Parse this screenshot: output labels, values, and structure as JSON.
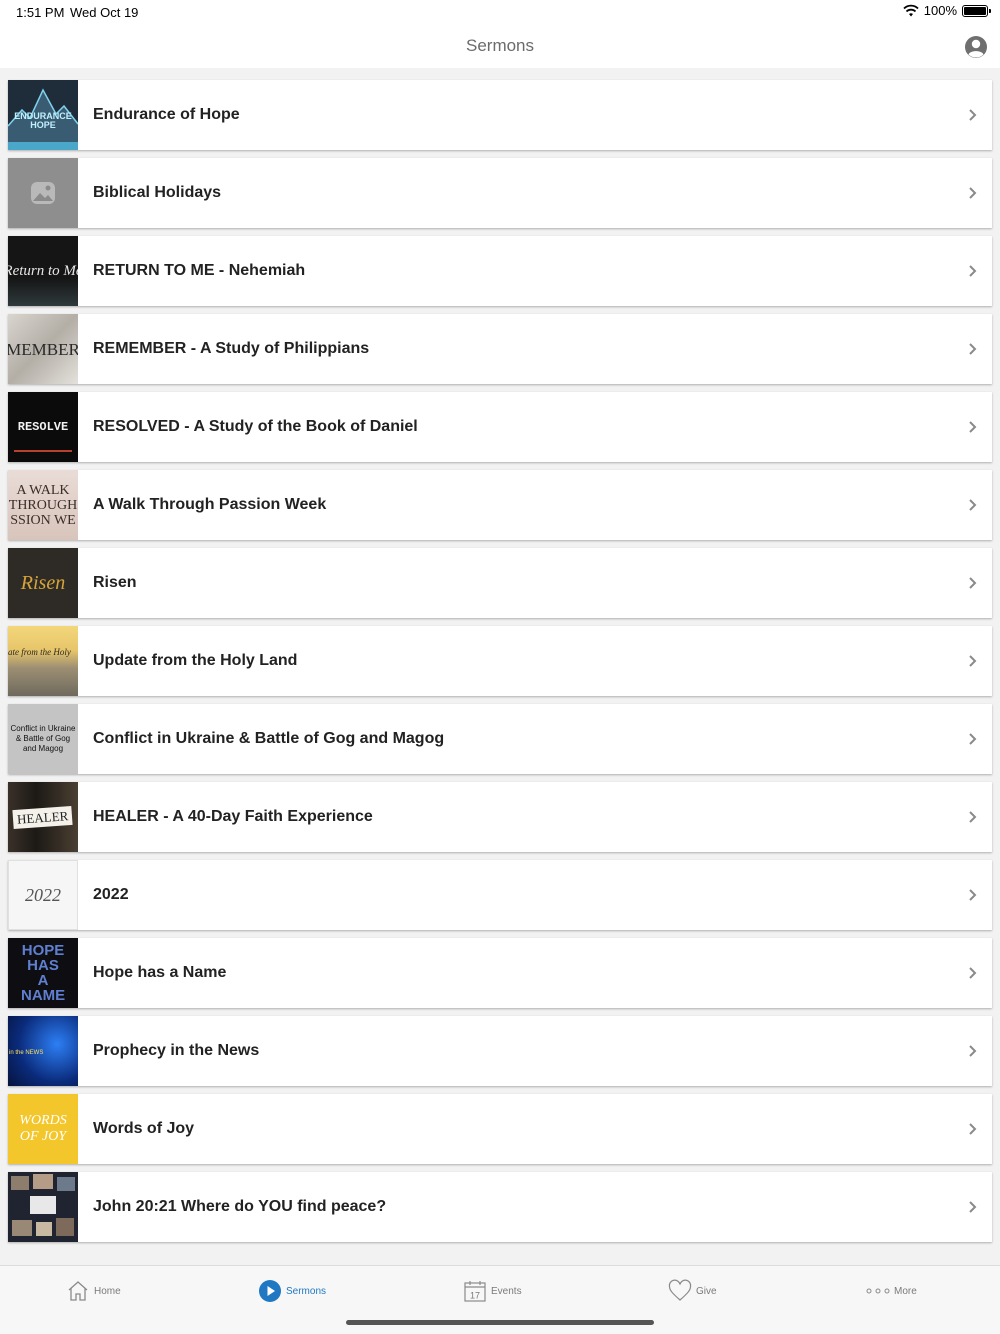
{
  "status_bar": {
    "time": "1:51 PM",
    "date": "Wed Oct 19",
    "battery": "100%"
  },
  "nav": {
    "title": "Sermons"
  },
  "sermons": [
    {
      "title": "Endurance of Hope",
      "thumb_text": "ENDURANCE HOPE",
      "thumb_icon": "mountain-art"
    },
    {
      "title": "Biblical Holidays",
      "thumb_text": "",
      "thumb_icon": "image-placeholder"
    },
    {
      "title": "RETURN TO ME - Nehemiah",
      "thumb_text": "Return to Me"
    },
    {
      "title": "REMEMBER - A Study of Philippians",
      "thumb_text": "MEMBER"
    },
    {
      "title": "RESOLVED - A Study of the Book of Daniel",
      "thumb_text": "RESOLVE"
    },
    {
      "title": "A Walk Through Passion Week",
      "thumb_text": "A WALK THROUGH SSION WE"
    },
    {
      "title": "Risen",
      "thumb_text": "Risen"
    },
    {
      "title": "Update from the Holy Land",
      "thumb_text": "ate from the Holy"
    },
    {
      "title": "Conflict in Ukraine & Battle of Gog and Magog",
      "thumb_text": "Conflict in Ukraine & Battle of Gog and Magog"
    },
    {
      "title": "HEALER - A 40-Day Faith Experience",
      "thumb_text": "HEALER"
    },
    {
      "title": "2022",
      "thumb_text": "2022"
    },
    {
      "title": "Hope has a Name",
      "thumb_text": "HOPE HAS A NAME"
    },
    {
      "title": "Prophecy in the News",
      "thumb_text": "in the NEWS"
    },
    {
      "title": "Words of Joy",
      "thumb_text": "WORDS OF JOY"
    },
    {
      "title": "John 20:21 Where do YOU find peace?",
      "thumb_text": ""
    }
  ],
  "tabs": [
    {
      "label": "Home",
      "icon": "home-icon"
    },
    {
      "label": "Sermons",
      "icon": "play-circle-icon",
      "active": true
    },
    {
      "label": "Events",
      "icon": "calendar-icon",
      "day": "17"
    },
    {
      "label": "Give",
      "icon": "heart-icon"
    },
    {
      "label": "More",
      "icon": "more-dots-icon"
    }
  ],
  "colors": {
    "accent": "#1f78c1",
    "background": "#f2f2f2",
    "text": "#222222"
  }
}
